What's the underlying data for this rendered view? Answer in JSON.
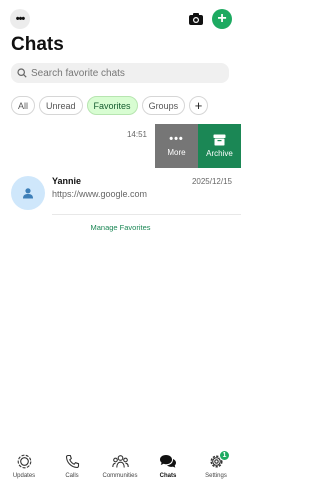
{
  "header": {
    "title": "Chats",
    "more_icon": "•••",
    "new_chat_icon": "+"
  },
  "search": {
    "placeholder": "Search favorite chats"
  },
  "filters": [
    {
      "label": "All",
      "active": false
    },
    {
      "label": "Unread",
      "active": false
    },
    {
      "label": "Favorites",
      "active": true
    },
    {
      "label": "Groups",
      "active": false
    },
    {
      "label": "+",
      "active": false
    }
  ],
  "swiped_chat": {
    "time": "14:51",
    "actions": {
      "more": "More",
      "archive": "Archive",
      "more_glyph": "•••"
    }
  },
  "chat": {
    "name": "Yannie",
    "preview": "https://www.google.com",
    "date": "2025/12/15"
  },
  "manage_favorites": "Manage Favorites",
  "bottom_nav": [
    {
      "label": "Updates",
      "icon": "updates-icon"
    },
    {
      "label": "Calls",
      "icon": "phone-icon"
    },
    {
      "label": "Communities",
      "icon": "communities-icon"
    },
    {
      "label": "Chats",
      "icon": "chats-icon",
      "active": true
    },
    {
      "label": "Settings",
      "icon": "gear-icon",
      "badge": "1"
    }
  ],
  "colors": {
    "accent": "#1daa61",
    "archive": "#1b8755",
    "more_action": "#767676",
    "active_chip": "#d8fdd2"
  }
}
